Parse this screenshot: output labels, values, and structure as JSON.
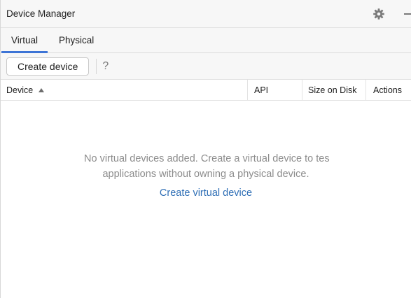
{
  "window": {
    "title": "Device Manager",
    "settings_icon": "gear-icon",
    "minimize_icon": "minimize-icon"
  },
  "tabs": [
    {
      "label": "Virtual",
      "active": true
    },
    {
      "label": "Physical",
      "active": false
    }
  ],
  "toolbar": {
    "create_label": "Create device",
    "help_label": "?"
  },
  "table": {
    "columns": [
      {
        "label": "Device",
        "sort": "ascending"
      },
      {
        "label": "API"
      },
      {
        "label": "Size on Disk"
      },
      {
        "label": "Actions"
      }
    ]
  },
  "empty_state": {
    "line1": "No virtual devices added. Create a virtual device to tes",
    "line2": "applications without owning a physical device.",
    "link_label": "Create virtual device"
  },
  "colors": {
    "accent": "#3d74d6",
    "link": "#2f6fb6",
    "muted_text": "#8c8c8c"
  }
}
